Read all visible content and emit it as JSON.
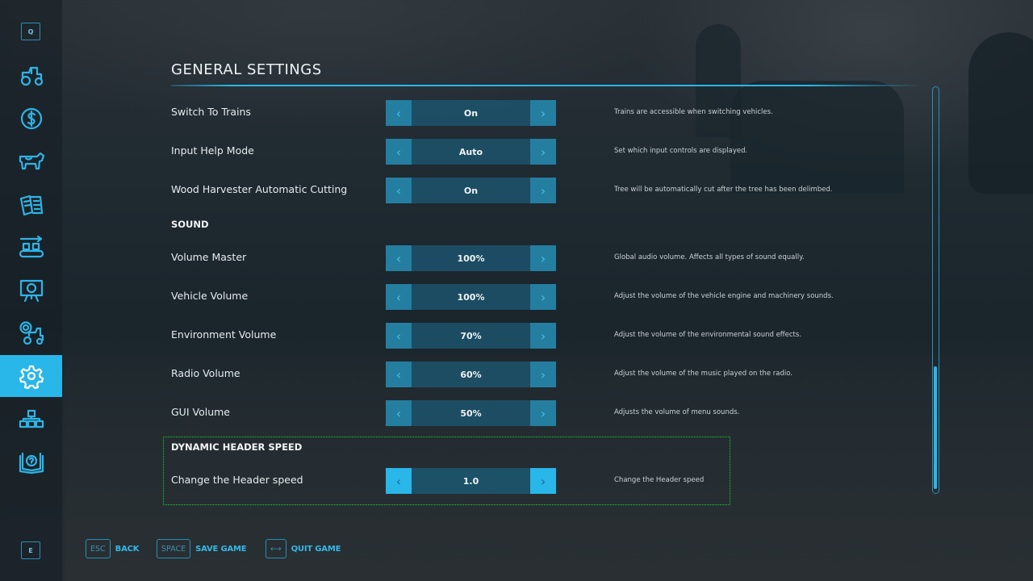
{
  "sidebar": {
    "top_key": "Q",
    "bottom_key": "E",
    "items": [
      {
        "name": "vehicles",
        "icon": "tractor-icon",
        "active": false
      },
      {
        "name": "finances",
        "icon": "dollar-icon",
        "active": false
      },
      {
        "name": "animals",
        "icon": "cow-icon",
        "active": false
      },
      {
        "name": "contracts",
        "icon": "documents-icon",
        "active": false
      },
      {
        "name": "production",
        "icon": "conveyor-icon",
        "active": false
      },
      {
        "name": "statistics",
        "icon": "presentation-chart-icon",
        "active": false
      },
      {
        "name": "garage",
        "icon": "gear-tractor-icon",
        "active": false
      },
      {
        "name": "settings",
        "icon": "gear-icon",
        "active": true
      },
      {
        "name": "controls",
        "icon": "blocks-icon",
        "active": false
      },
      {
        "name": "help",
        "icon": "help-book-icon",
        "active": false
      }
    ]
  },
  "page": {
    "title": "GENERAL SETTINGS"
  },
  "settings": [
    {
      "label": "Switch To Trains",
      "value": "On",
      "description": "Trains are accessible when switching vehicles."
    },
    {
      "label": "Input Help Mode",
      "value": "Auto",
      "description": "Set which input controls are displayed."
    },
    {
      "label": "Wood Harvester Automatic Cutting",
      "value": "On",
      "description": "Tree will be automatically cut after the tree has been delimbed."
    }
  ],
  "sound": {
    "header": "SOUND",
    "items": [
      {
        "label": "Volume Master",
        "value": "100%",
        "description": "Global audio volume. Affects all types of sound equally."
      },
      {
        "label": "Vehicle Volume",
        "value": "100%",
        "description": "Adjust the volume of the vehicle engine and machinery sounds."
      },
      {
        "label": "Environment Volume",
        "value": "70%",
        "description": "Adjust the volume of the environmental sound effects."
      },
      {
        "label": "Radio Volume",
        "value": "60%",
        "description": "Adjust the volume of the music played on the radio."
      },
      {
        "label": "GUI Volume",
        "value": "50%",
        "description": "Adjusts the volume of menu sounds."
      }
    ]
  },
  "dynamic_header": {
    "header": "DYNAMIC HEADER SPEED",
    "items": [
      {
        "label": "Change the Header speed",
        "value": "1.0",
        "description": "Change the Header speed",
        "focused": true
      }
    ]
  },
  "scroll": {
    "position_fraction": 0.69,
    "visible_fraction": 0.31
  },
  "footer": {
    "back": {
      "key": "ESC",
      "label": "BACK"
    },
    "save": {
      "key": "SPACE",
      "label": "SAVE GAME"
    },
    "quit": {
      "key": "⟷",
      "label": "QUIT GAME"
    }
  },
  "colors": {
    "accent": "#29b6e8",
    "focus_outline": "#18d12a"
  }
}
